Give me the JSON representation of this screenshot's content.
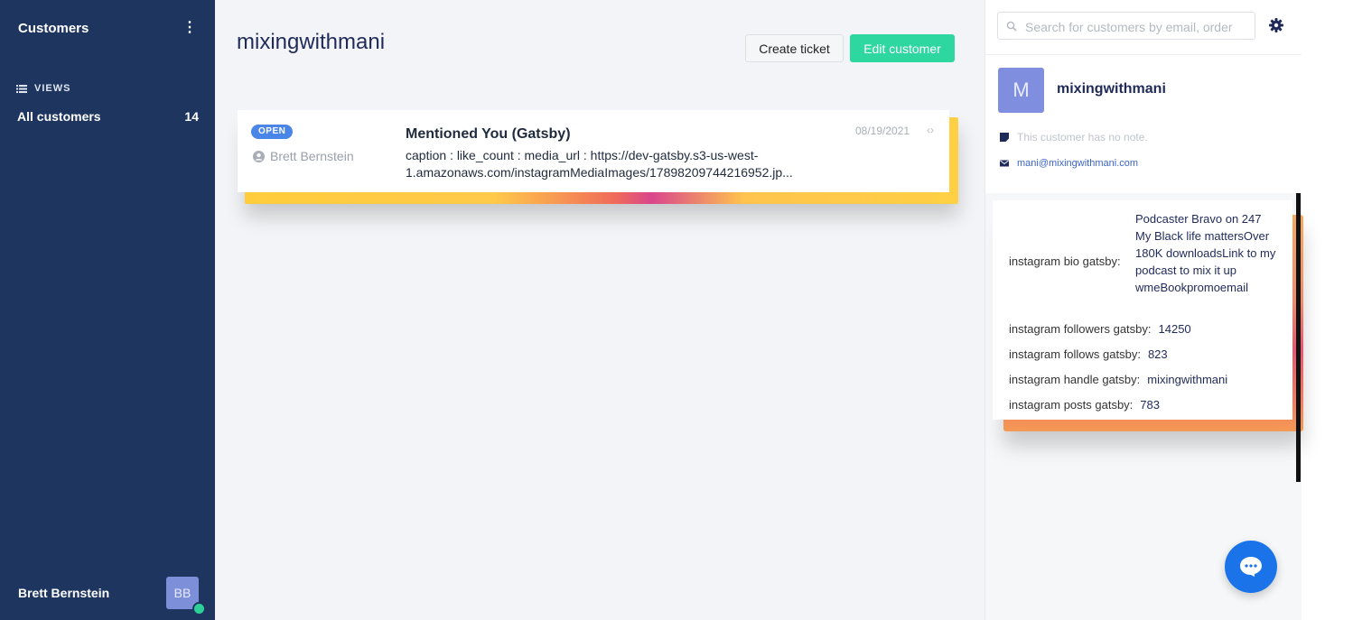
{
  "sidebar": {
    "title": "Customers",
    "menu_icon": "kebab-icon",
    "views_label": "VIEWS",
    "views_icon": "list-icon",
    "items": [
      {
        "label": "All customers",
        "count": "14"
      }
    ],
    "user_name": "Brett Bernstein",
    "user_initials": "BB",
    "status_color": "#2bd197"
  },
  "main": {
    "title": "mixingwithmani",
    "create_ticket": "Create ticket",
    "edit_customer": "Edit customer",
    "ticket": {
      "status": "OPEN",
      "author": "Brett Bernstein",
      "subject": "Mentioned You (Gatsby)",
      "body": "caption : like_count : media_url : https://dev-gatsby.s3-us-west-1.amazonaws.com/instagramMediaImages/17898209744216952.jp...",
      "date": "08/19/2021",
      "channel_icon": "code-icon",
      "channel_glyph": "‹›"
    }
  },
  "right": {
    "search_placeholder": "Search for customers by email, order",
    "customer": {
      "initial": "M",
      "name": "mixingwithmani",
      "note": "This customer has no note.",
      "email": "mani@mixingwithmani.com"
    },
    "instagram": {
      "bio_label": "instagram bio gatsby:",
      "bio": "Podcaster Bravo on 247 My Black life mattersOver 180K downloadsLink to my podcast to mix it up wmeBookpromoemail",
      "followers_label": "instagram followers gatsby:",
      "followers": "14250",
      "follows_label": "instagram follows gatsby:",
      "follows": "823",
      "handle_label": "instagram handle gatsby:",
      "handle": "mixingwithmani",
      "posts_label": "instagram posts gatsby:",
      "posts": "783"
    }
  },
  "colors": {
    "sidebar_bg": "#1e3560",
    "accent_green": "#2ed7a0",
    "badge_blue": "#4a86e8",
    "chat_blue": "#1a73e8"
  }
}
